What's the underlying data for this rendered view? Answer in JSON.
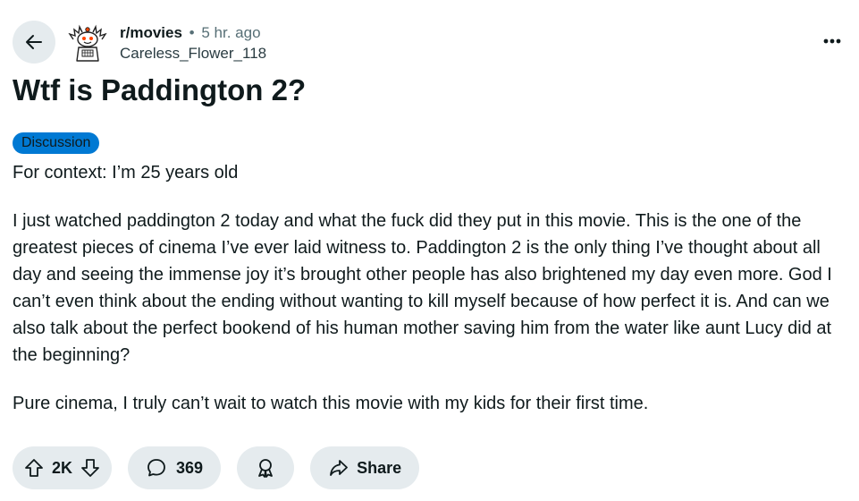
{
  "post": {
    "subreddit": "r/movies",
    "separator": "•",
    "time": "5 hr. ago",
    "author": "Careless_Flower_118",
    "title": "Wtf is Paddington 2?",
    "flair": "Discussion",
    "paragraphs": [
      "For context: I’m 25 years old",
      "I just watched paddington 2 today and what the fuck did they put in this movie. This is the one of the greatest pieces of cinema I’ve ever laid witness to. Paddington 2 is the only thing I’ve thought about all day and seeing the immense joy it’s brought other people has also brightened my day even more. God I can’t even think about the ending without wanting to kill myself because of how perfect it is. And can we also talk about the perfect bookend of his human mother saving him from the water like aunt Lucy did at the beginning?",
      "Pure cinema, I truly can’t wait to watch this movie with my kids for their first time."
    ]
  },
  "actions": {
    "votes": "2K",
    "comments": "369",
    "share_label": "Share"
  },
  "icons": {
    "back": "arrow-left-icon",
    "more": "more-horizontal-icon",
    "upvote": "upvote-arrow-icon",
    "downvote": "downvote-arrow-icon",
    "comment": "speech-bubble-icon",
    "award": "award-ribbon-icon",
    "share": "share-arrow-icon",
    "avatar": "snoo-avatar-icon"
  },
  "colors": {
    "flair_bg": "#0079d3",
    "pill_bg": "#e5ebee",
    "meta_gray": "#576f76",
    "text": "#0f1a1c"
  }
}
